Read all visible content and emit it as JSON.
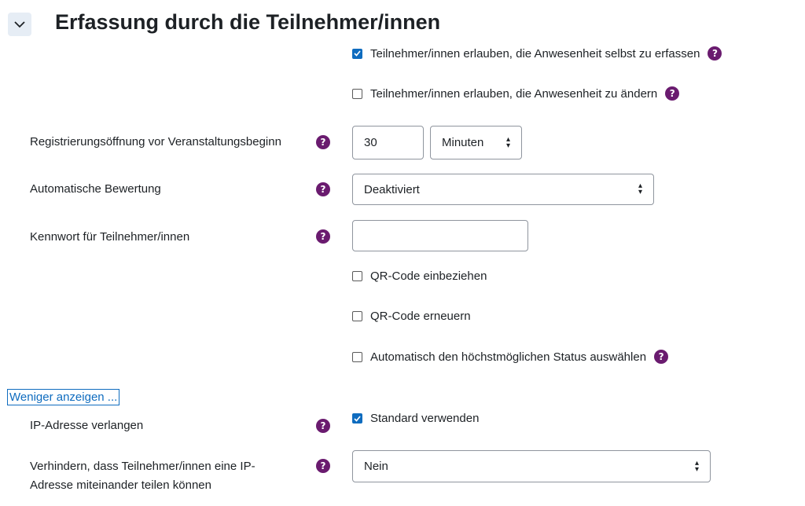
{
  "section": {
    "title": "Erfassung durch die Teilnehmer/innen"
  },
  "self_record": {
    "label": "Teilnehmer/innen erlauben, die Anwesenheit selbst zu erfassen",
    "checked": true
  },
  "allow_change": {
    "label": "Teilnehmer/innen erlauben, die Anwesenheit zu ändern",
    "checked": false
  },
  "registration": {
    "label": "Registrierungsöffnung vor Veranstaltungsbeginn",
    "value": "30",
    "unit": "Minuten"
  },
  "autograde": {
    "label": "Automatische Bewertung",
    "value": "Deaktiviert"
  },
  "password": {
    "label": "Kennwort für Teilnehmer/innen",
    "value": ""
  },
  "qr_include": {
    "label": "QR-Code einbeziehen",
    "checked": false
  },
  "qr_renew": {
    "label": "QR-Code erneuern",
    "checked": false
  },
  "auto_status": {
    "label": "Automatisch den höchstmöglichen Status auswählen",
    "checked": false
  },
  "show_less": {
    "label": "Weniger anzeigen ..."
  },
  "ip_required": {
    "label": "IP-Adresse verlangen",
    "option_label": "Standard verwenden",
    "checked": true
  },
  "prevent_shared_ip": {
    "label_line1": "Verhindern, dass Teilnehmer/innen eine IP-",
    "label_line2": "Adresse miteinander teilen können",
    "value": "Nein"
  },
  "colors": {
    "accent": "#0f6cbf",
    "help": "#6a1b6f",
    "text": "#1d2125"
  }
}
